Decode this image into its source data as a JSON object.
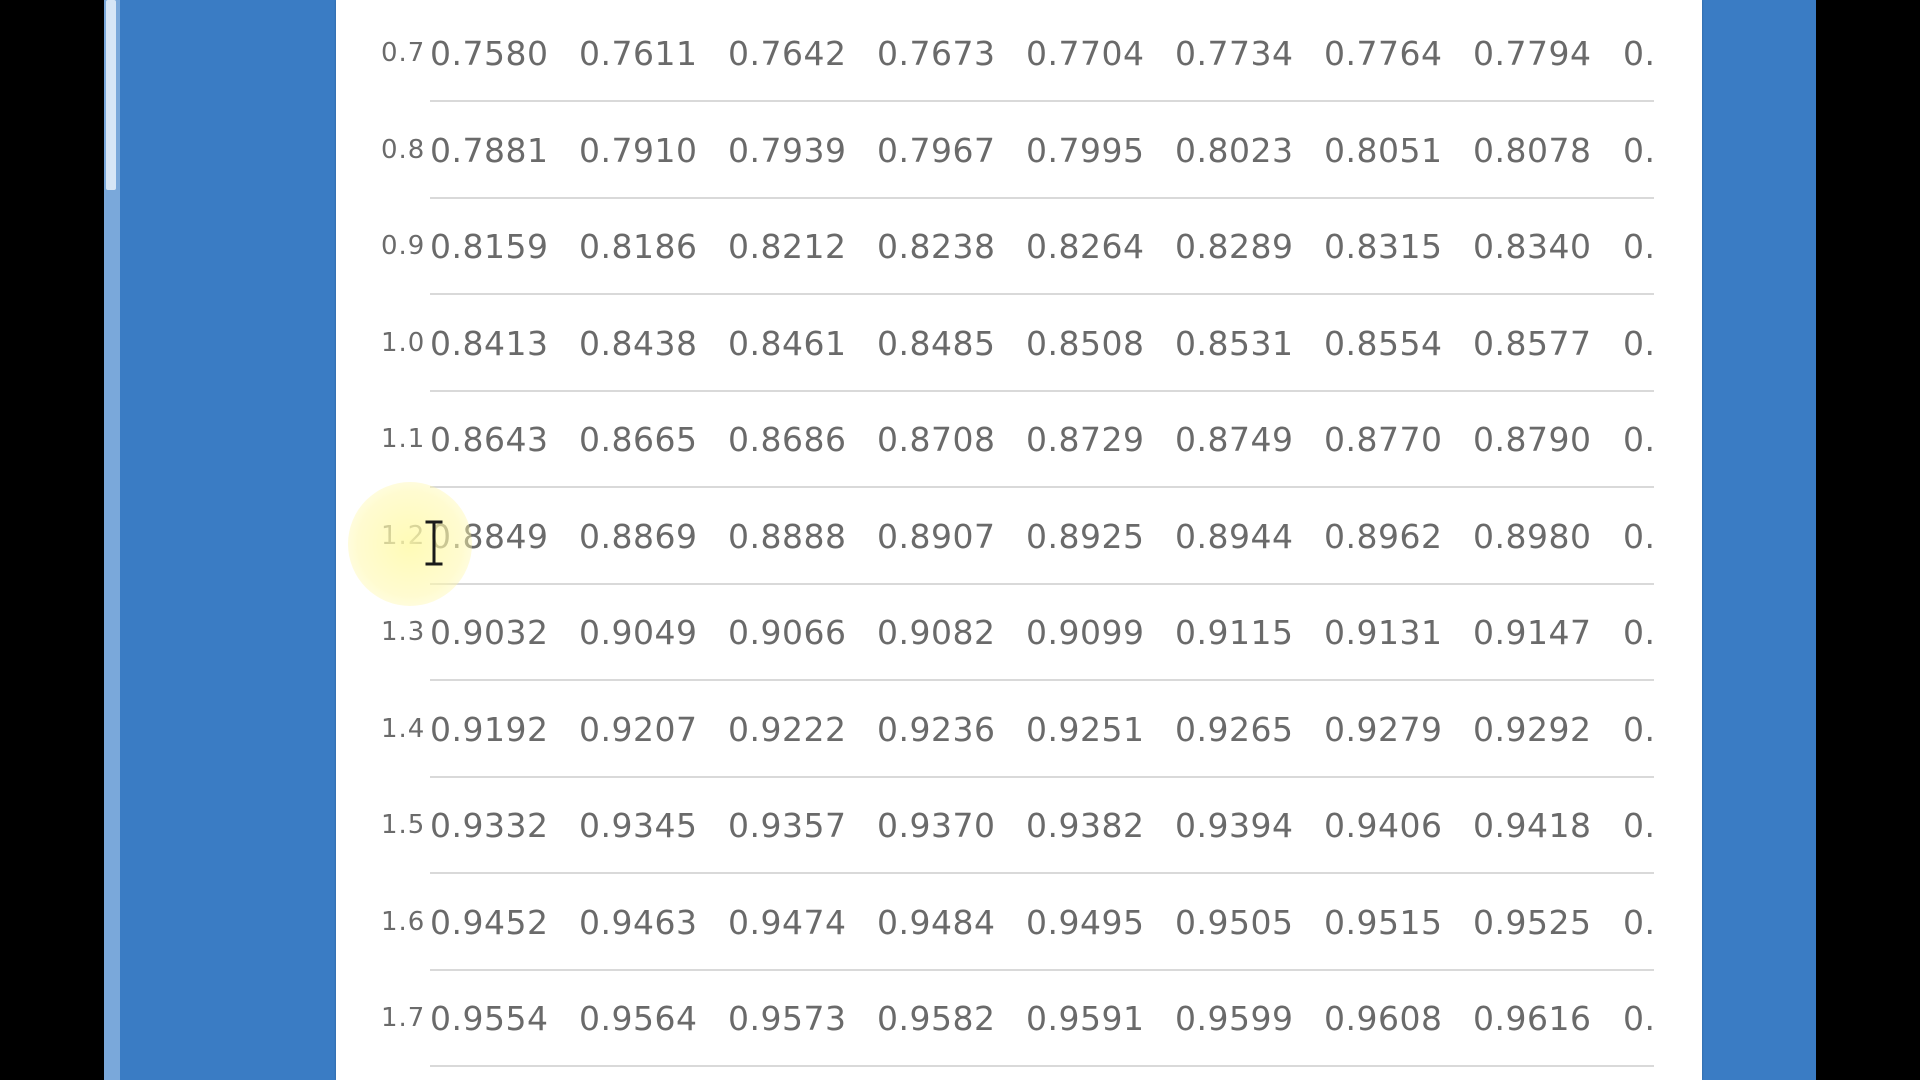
{
  "colors": {
    "background": "#000000",
    "frame": "#3a7cc4",
    "page": "#ffffff",
    "text": "#6a6a6a",
    "rule": "#d9d9d9",
    "highlight": "#fff8aa"
  },
  "cursor_icon": "text-ibeam-icon",
  "table": {
    "rows": [
      {
        "z": "0.7",
        "values": [
          "0.7580",
          "0.7611",
          "0.7642",
          "0.7673",
          "0.7704",
          "0.7734",
          "0.7764",
          "0.7794",
          "0."
        ]
      },
      {
        "z": "0.8",
        "values": [
          "0.7881",
          "0.7910",
          "0.7939",
          "0.7967",
          "0.7995",
          "0.8023",
          "0.8051",
          "0.8078",
          "0."
        ]
      },
      {
        "z": "0.9",
        "values": [
          "0.8159",
          "0.8186",
          "0.8212",
          "0.8238",
          "0.8264",
          "0.8289",
          "0.8315",
          "0.8340",
          "0."
        ]
      },
      {
        "z": "1.0",
        "values": [
          "0.8413",
          "0.8438",
          "0.8461",
          "0.8485",
          "0.8508",
          "0.8531",
          "0.8554",
          "0.8577",
          "0."
        ]
      },
      {
        "z": "1.1",
        "values": [
          "0.8643",
          "0.8665",
          "0.8686",
          "0.8708",
          "0.8729",
          "0.8749",
          "0.8770",
          "0.8790",
          "0."
        ]
      },
      {
        "z": "1.2",
        "values": [
          "0.8849",
          "0.8869",
          "0.8888",
          "0.8907",
          "0.8925",
          "0.8944",
          "0.8962",
          "0.8980",
          "0."
        ]
      },
      {
        "z": "1.3",
        "values": [
          "0.9032",
          "0.9049",
          "0.9066",
          "0.9082",
          "0.9099",
          "0.9115",
          "0.9131",
          "0.9147",
          "0."
        ]
      },
      {
        "z": "1.4",
        "values": [
          "0.9192",
          "0.9207",
          "0.9222",
          "0.9236",
          "0.9251",
          "0.9265",
          "0.9279",
          "0.9292",
          "0."
        ]
      },
      {
        "z": "1.5",
        "values": [
          "0.9332",
          "0.9345",
          "0.9357",
          "0.9370",
          "0.9382",
          "0.9394",
          "0.9406",
          "0.9418",
          "0."
        ]
      },
      {
        "z": "1.6",
        "values": [
          "0.9452",
          "0.9463",
          "0.9474",
          "0.9484",
          "0.9495",
          "0.9505",
          "0.9515",
          "0.9525",
          "0."
        ]
      },
      {
        "z": "1.7",
        "values": [
          "0.9554",
          "0.9564",
          "0.9573",
          "0.9582",
          "0.9591",
          "0.9599",
          "0.9608",
          "0.9616",
          "0."
        ]
      }
    ]
  }
}
